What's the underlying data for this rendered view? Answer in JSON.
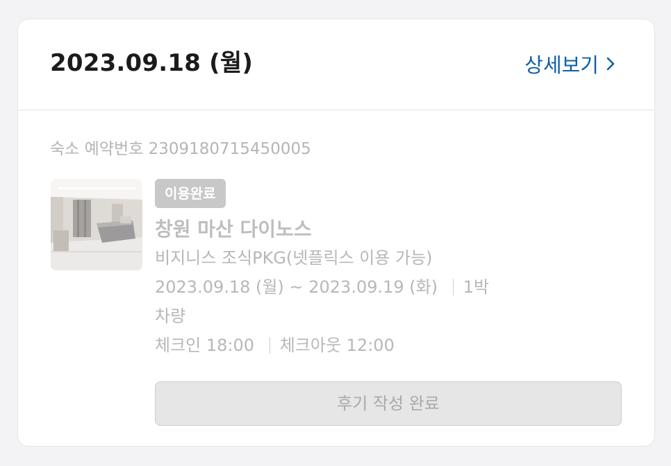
{
  "card": {
    "date_title": "2023.09.18 (월)",
    "detail_link": "상세보기",
    "booking_label": "숙소 예약번호",
    "booking_number": "2309180715450005",
    "status_badge": "이용완료",
    "hotel_name": "창원 마산 다이노스",
    "room_name": "비지니스 조식PKG(넷플릭스 이용 가능)",
    "checkin_date": "2023.09.18 (월)",
    "date_separator": "~",
    "checkout_date": "2023.09.19 (화)",
    "nights": "1박",
    "parking": "차량",
    "checkin_label": "체크인",
    "checkin_time": "18:00",
    "checkout_label": "체크아웃",
    "checkout_time": "12:00",
    "review_button": "후기 작성 완료"
  },
  "colors": {
    "link": "#0f5fa6",
    "badge_bg": "#c8c8c8",
    "muted_text": "#b7b7b7",
    "button_bg": "#e6e6e6"
  },
  "icons": {
    "detail_chevron": "chevron-right-icon"
  }
}
